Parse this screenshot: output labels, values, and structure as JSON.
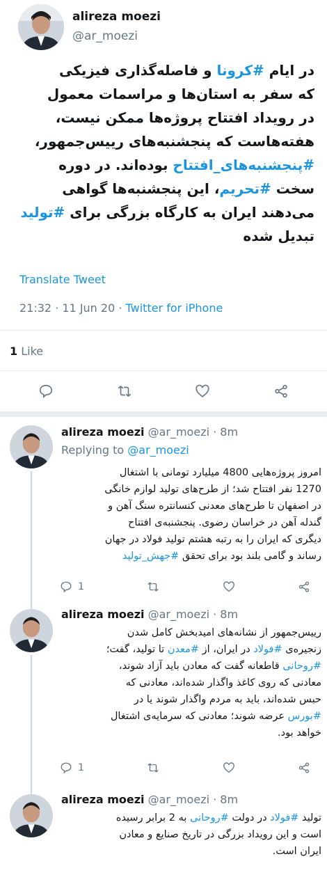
{
  "main_tweet": {
    "author_name": "alireza moezi",
    "author_handle": "@ar_moezi",
    "body_lines": [
      {
        "parts": [
          {
            "t": "در ایام "
          },
          {
            "t": "#کرونا",
            "h": true
          },
          {
            "t": " و فاصله‌گذاری فیزیکی"
          }
        ]
      },
      {
        "parts": [
          {
            "t": "که سفر به استان‌ها و مراسمات معمول"
          }
        ]
      },
      {
        "parts": [
          {
            "t": "در رویداد افتتاح پروژه‌ها ممکن نیست،"
          }
        ]
      },
      {
        "parts": [
          {
            "t": "هفته‌هاست که پنجشنبه‌های رییس‌جمهور،"
          }
        ]
      },
      {
        "parts": [
          {
            "t": "#پنجشنبه‌های_افتتاح",
            "h": true
          },
          {
            "t": " بوده‌اند. در دوره"
          }
        ]
      },
      {
        "parts": [
          {
            "t": "سخت "
          },
          {
            "t": "#تحریم",
            "h": true
          },
          {
            "t": "، این پنجشنبه‌ها گواهی"
          }
        ]
      },
      {
        "parts": [
          {
            "t": "می‌دهند ایران به کارگاه بزرگی برای "
          },
          {
            "t": "#تولید",
            "h": true
          }
        ]
      },
      {
        "parts": [
          {
            "t": "تبدیل شده"
          }
        ]
      }
    ],
    "translate_label": "Translate Tweet",
    "timestamp": "21:32 · 11 Jun 20 · ",
    "source": "Twitter for iPhone",
    "likes_count": "1",
    "likes_label": " Like"
  },
  "replies": [
    {
      "name": "alireza moezi",
      "meta": " @ar_moezi · 8m",
      "replying_label": "Replying to ",
      "replying_handle": "@ar_moezi",
      "lines": [
        {
          "parts": [
            {
              "t": "امروز پروژه‌هایی 4800 میلیارد تومانی با اشتغال"
            }
          ]
        },
        {
          "parts": [
            {
              "t": "1270 نفر افتتاح شد؛ از طرح‌های تولید لوازم خانگی"
            }
          ]
        },
        {
          "parts": [
            {
              "t": "در اصفهان تا طرح‌های معدنی کنسانتره سنگ آهن و"
            }
          ]
        },
        {
          "parts": [
            {
              "t": "گندله آهن در خراسان رضوی. پنجشنبه‌ی افتتاح"
            }
          ]
        },
        {
          "parts": [
            {
              "t": "دیگری که ایران را به رتبه هشتم تولید فولاد در جهان"
            }
          ]
        },
        {
          "parts": [
            {
              "t": "رساند و گامی بلند بود برای تحقق "
            },
            {
              "t": "#جهش_تولید",
              "h": true
            }
          ]
        }
      ],
      "reply_count": "1",
      "like_count": ""
    },
    {
      "name": "alireza moezi",
      "meta": " @ar_moezi · 8m",
      "lines": [
        {
          "parts": [
            {
              "t": "رییس‌جمهور از نشانه‌های امیدبخش کامل شدن"
            }
          ]
        },
        {
          "parts": [
            {
              "t": "زنجیره‌ی "
            },
            {
              "t": "#فولاد",
              "h": true
            },
            {
              "t": " در ایران، از "
            },
            {
              "t": "#معدن",
              "h": true
            },
            {
              "t": " تا تولید، گفت؛"
            }
          ]
        },
        {
          "parts": [
            {
              "t": "#روحانی",
              "h": true
            },
            {
              "t": " قاطعانه گفت که معادن باید آزاد شوند،"
            }
          ]
        },
        {
          "parts": [
            {
              "t": "معادنی که روی کاغذ واگذار شده‌اند، معادنی که"
            }
          ]
        },
        {
          "parts": [
            {
              "t": "حبس شده‌اند، باید به مردم واگذار شوند یا در"
            }
          ]
        },
        {
          "parts": [
            {
              "t": "#بورس",
              "h": true
            },
            {
              "t": " عرضه شوند؛ معادنی که سرمایه‌ی اشتغال"
            }
          ]
        },
        {
          "parts": [
            {
              "t": "خواهد بود."
            }
          ]
        }
      ],
      "reply_count": "1",
      "like_count": ""
    },
    {
      "name": "alireza moezi",
      "meta": " @ar_moezi · 8m",
      "lines": [
        {
          "parts": [
            {
              "t": "تولید "
            },
            {
              "t": "#فولاد",
              "h": true
            },
            {
              "t": " در دولت "
            },
            {
              "t": "#روحانی",
              "h": true
            },
            {
              "t": " به 2 برابر رسیده"
            }
          ]
        },
        {
          "parts": [
            {
              "t": "است و این رویداد بزرگی در تاریخ صنایع و معادن"
            }
          ]
        },
        {
          "parts": [
            {
              "t": "ایران است."
            }
          ]
        }
      ]
    }
  ],
  "colors": {
    "link": "#1b95e0",
    "muted": "#657786",
    "text": "#14171a",
    "divider": "#e6ecf0"
  }
}
